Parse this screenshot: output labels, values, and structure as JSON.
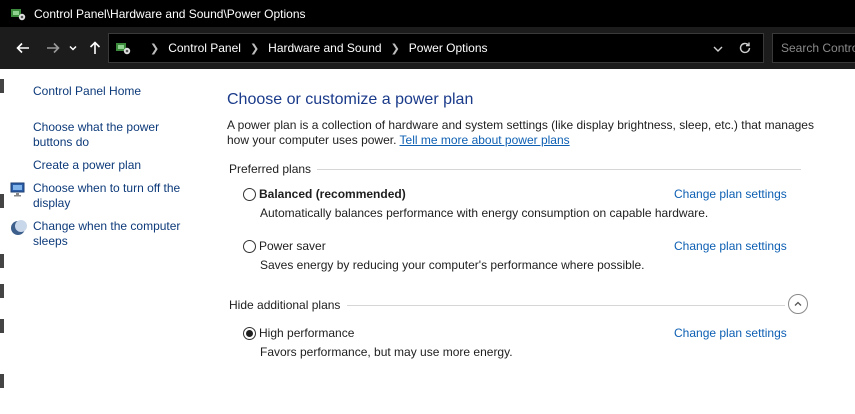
{
  "window": {
    "title": "Control Panel\\Hardware and Sound\\Power Options",
    "icon": "control-panel-icon"
  },
  "navigation": {
    "breadcrumbs": [
      "Control Panel",
      "Hardware and Sound",
      "Power Options"
    ],
    "search_placeholder": "Search Contro"
  },
  "sidebar": {
    "items": [
      {
        "label": "Control Panel Home",
        "icon": null
      },
      {
        "label": "Choose what the power buttons do",
        "icon": null
      },
      {
        "label": "Create a power plan",
        "icon": null
      },
      {
        "label": "Choose when to turn off the display",
        "icon": "display-icon"
      },
      {
        "label": "Change when the computer sleeps",
        "icon": "moon-icon"
      }
    ]
  },
  "main": {
    "heading": "Choose or customize a power plan",
    "intro": "A power plan is a collection of hardware and system settings (like display brightness, sleep, etc.) that manages how your computer uses power.",
    "intro_link": "Tell me more about power plans",
    "preferred_label": "Preferred plans",
    "additional_label": "Hide additional plans",
    "change_label": "Change plan settings",
    "plans": [
      {
        "name": "Balanced (recommended)",
        "description": "Automatically balances performance with energy consumption on capable hardware.",
        "selected": false
      },
      {
        "name": "Power saver",
        "description": "Saves energy by reducing your computer's performance where possible.",
        "selected": false
      },
      {
        "name": "High performance",
        "description": "Favors performance, but may use more energy.",
        "selected": true
      }
    ]
  },
  "colors": {
    "link": "#0d5fb3",
    "heading": "#1a3a8a",
    "titlebar": "#000000"
  }
}
